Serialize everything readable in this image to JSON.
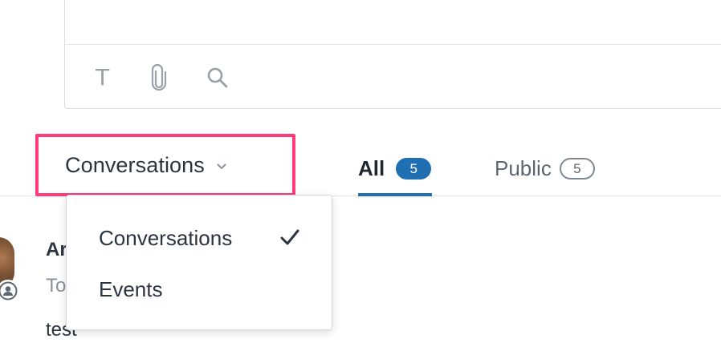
{
  "composer": {
    "tools": [
      {
        "icon": "text-format-icon",
        "glyph": "T"
      },
      {
        "icon": "paperclip-icon"
      },
      {
        "icon": "search-icon"
      }
    ]
  },
  "filter": {
    "selected_label": "Conversations",
    "highlight_color": "#ff3b7a"
  },
  "tabs": [
    {
      "label": "All",
      "count": "5",
      "active": true
    },
    {
      "label": "Public",
      "count": "5",
      "active": false
    }
  ],
  "menu": {
    "items": [
      {
        "label": "Conversations",
        "checked": true
      },
      {
        "label": "Events",
        "checked": false
      }
    ]
  },
  "conversation": {
    "author_partial": "Ar",
    "to_partial": "To",
    "body": "test"
  },
  "colors": {
    "accent": "#1f6fb2",
    "text": "#2c3440",
    "muted": "#8a939c"
  }
}
